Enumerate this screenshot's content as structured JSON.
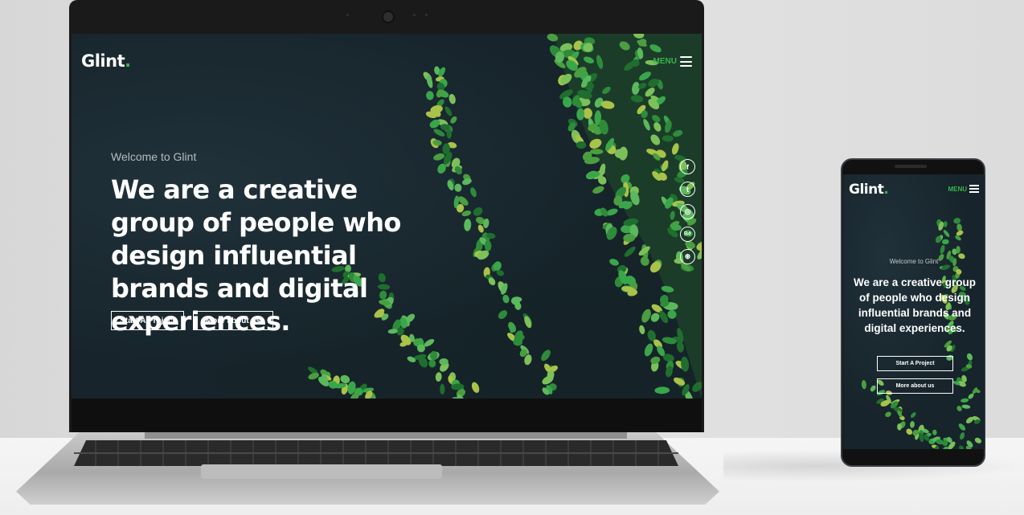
{
  "site": {
    "brand_text": "Glint",
    "brand_dot": ".",
    "menu_label": "MENU",
    "accent_color": "#39b54a",
    "hero": {
      "welcome": "Welcome to Glint",
      "headline": "We are a creative group of people who design influential brands and digital experiences.",
      "primary_button": "Start A Project",
      "secondary_button": "More about us"
    },
    "social_icons": [
      "facebook-icon",
      "twitter-icon",
      "instagram-icon",
      "behance-icon",
      "dribbble-icon"
    ],
    "social_glyphs": [
      "f",
      "t",
      "◎",
      "Bē",
      "⊛"
    ]
  }
}
